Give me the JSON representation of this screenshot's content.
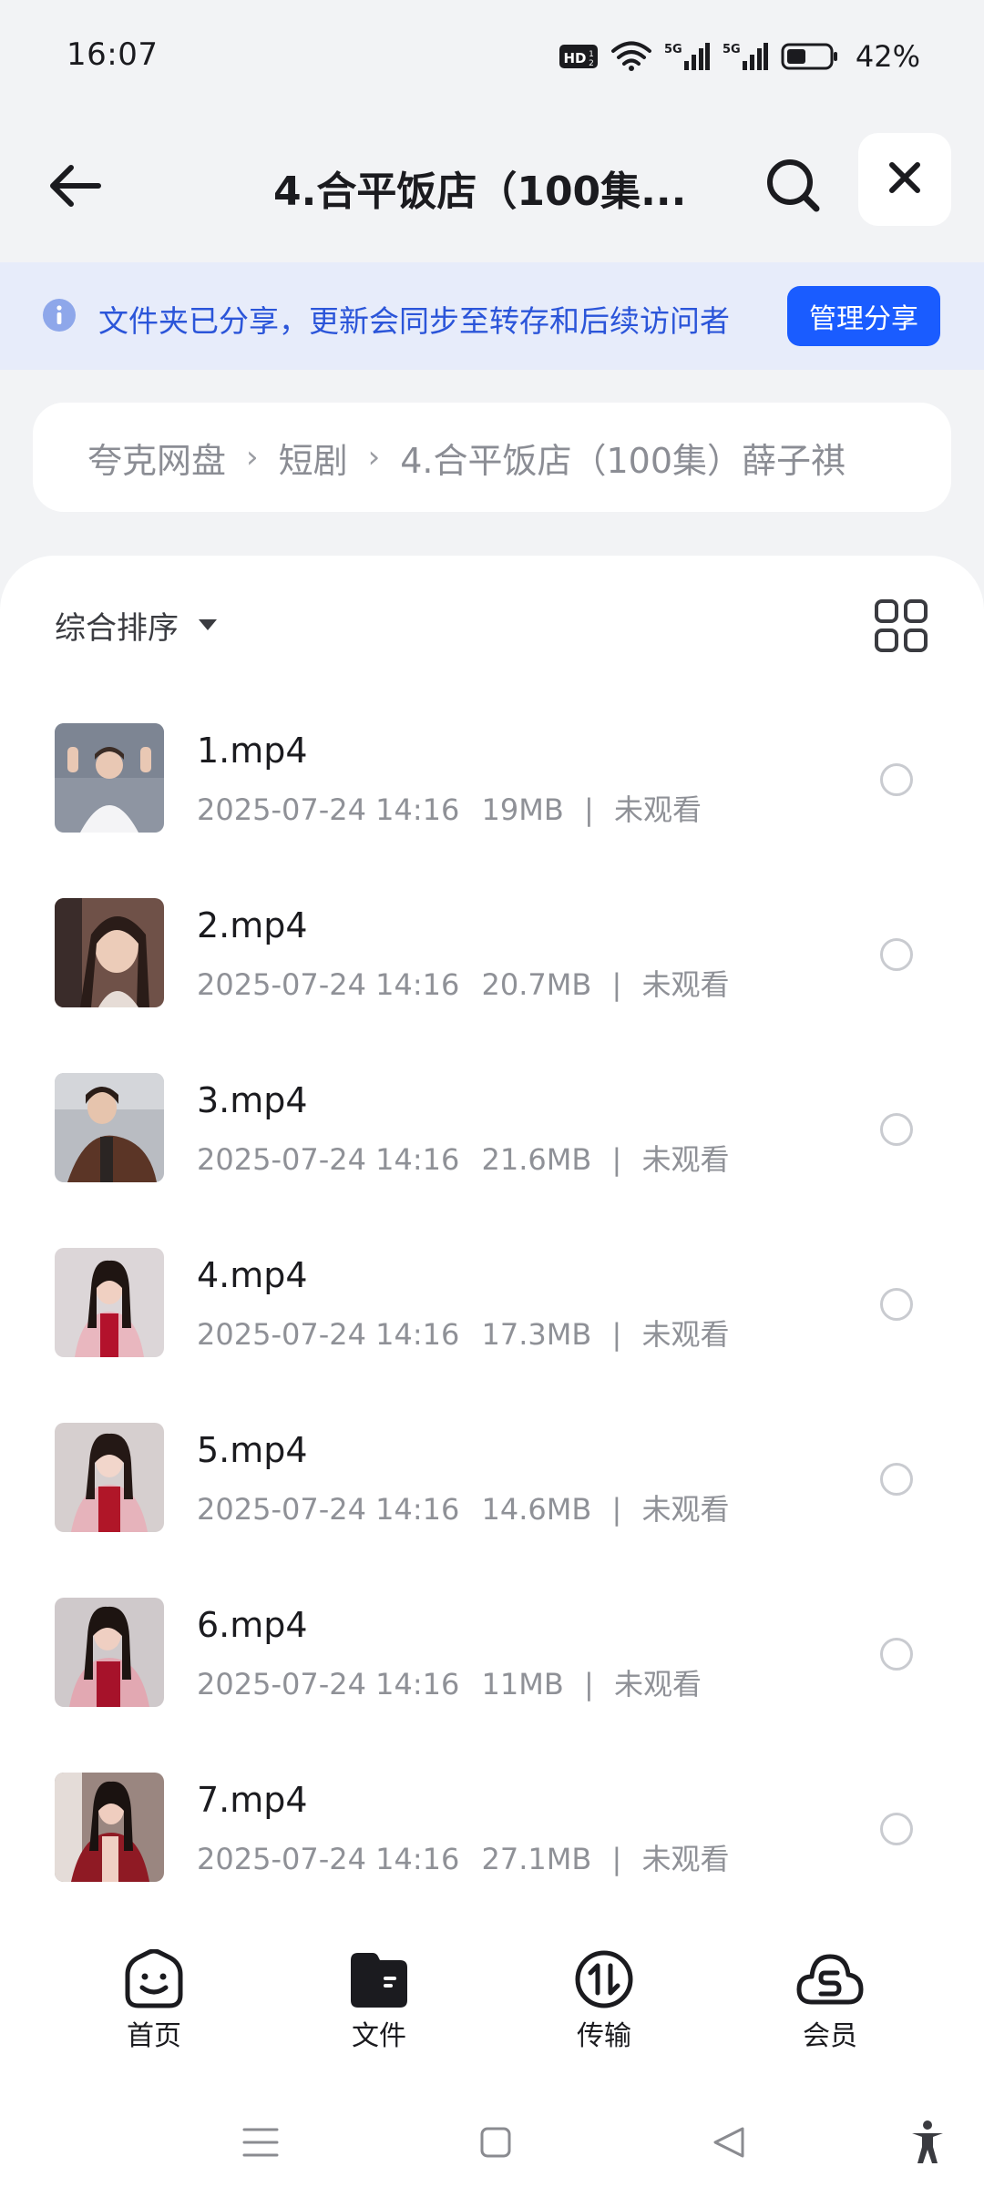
{
  "status_bar": {
    "time": "16:07",
    "hd_label": "HD",
    "network_1": "5G",
    "network_2": "5G",
    "battery": "42%"
  },
  "header": {
    "title": "4.合平饭店（100集..."
  },
  "share_banner": {
    "text": "文件夹已分享，更新会同步至转存和后续访问者",
    "button": "管理分享"
  },
  "breadcrumb": {
    "items": [
      "夸克网盘",
      "短剧",
      "4.合平饭店（100集）薛子祺"
    ]
  },
  "toolbar": {
    "sort_label": "综合排序"
  },
  "files": [
    {
      "name": "1.mp4",
      "date": "2025-07-24 14:16",
      "size": "19MB",
      "status": "未观看"
    },
    {
      "name": "2.mp4",
      "date": "2025-07-24 14:16",
      "size": "20.7MB",
      "status": "未观看"
    },
    {
      "name": "3.mp4",
      "date": "2025-07-24 14:16",
      "size": "21.6MB",
      "status": "未观看"
    },
    {
      "name": "4.mp4",
      "date": "2025-07-24 14:16",
      "size": "17.3MB",
      "status": "未观看"
    },
    {
      "name": "5.mp4",
      "date": "2025-07-24 14:16",
      "size": "14.6MB",
      "status": "未观看"
    },
    {
      "name": "6.mp4",
      "date": "2025-07-24 14:16",
      "size": "11MB",
      "status": "未观看"
    },
    {
      "name": "7.mp4",
      "date": "2025-07-24 14:16",
      "size": "27.1MB",
      "status": "未观看"
    }
  ],
  "bottom_nav": {
    "home": "首页",
    "files": "文件",
    "transfer": "传输",
    "member": "会员"
  },
  "colors": {
    "accent": "#1a5cff",
    "banner_bg": "#e7ecfa",
    "banner_text": "#2b55d9",
    "muted_text": "#8f9197"
  }
}
